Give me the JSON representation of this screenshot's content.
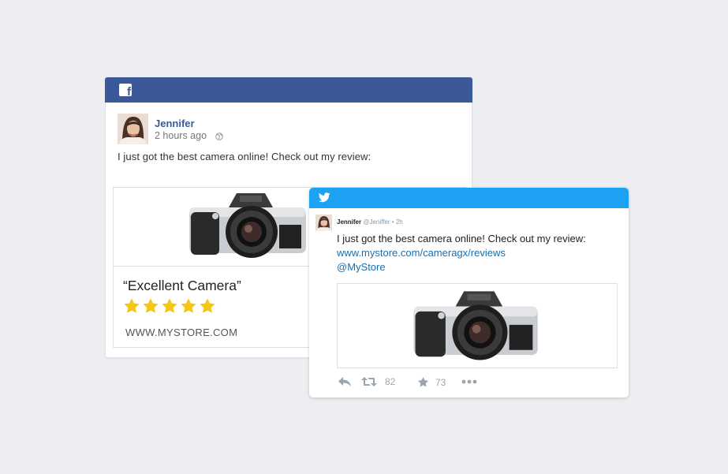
{
  "facebook": {
    "logo_glyph": "f",
    "author": "Jennifer",
    "time": "2 hours ago",
    "status": "I just got the best camera online! Check out my review:",
    "link": {
      "title": "“Excellent Camera”",
      "rating": 5,
      "domain": "WWW.MYSTORE.COM"
    },
    "colors": {
      "header": "#3b5998",
      "star": "#f5c518"
    }
  },
  "twitter": {
    "author": "Jennifer",
    "handle_time": "@Jeniffer • 2h",
    "text": "I just got the best camera online! Check out my review:",
    "url": "www.mystore.com/cameragx/reviews",
    "mention": "@MyStore",
    "retweets": "82",
    "favorites": "73",
    "colors": {
      "header": "#1da1f2",
      "link": "#1b6fb0"
    }
  }
}
